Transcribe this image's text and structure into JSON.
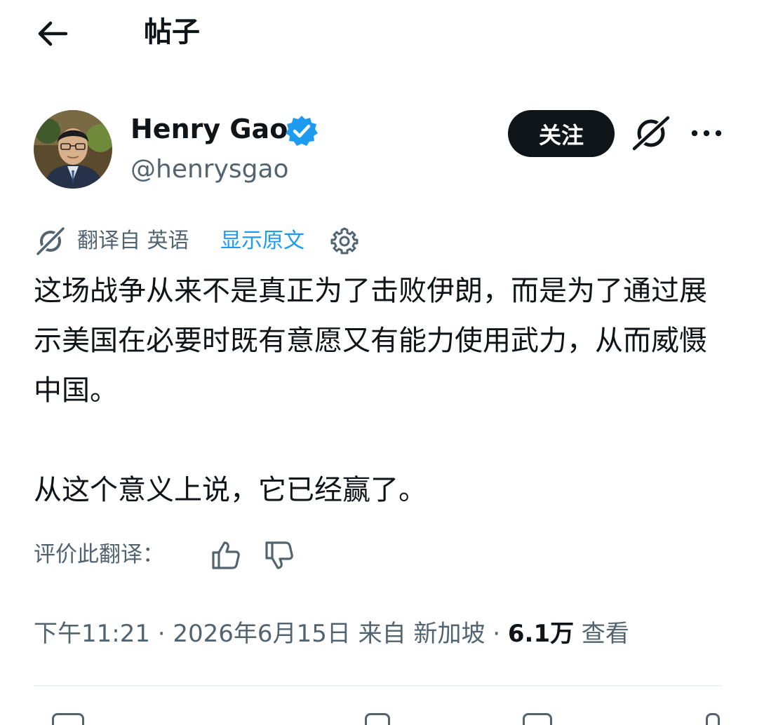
{
  "header": {
    "title": "帖子",
    "back_icon": "arrow-left-icon"
  },
  "author": {
    "name": "Henry Gao",
    "handle": "@henrysgao",
    "verified": true,
    "verified_color": "#1d9bf0",
    "follow_label": "关注",
    "grok_icon": "grok-icon",
    "more_icon": "more-horizontal-icon"
  },
  "translation": {
    "label": "翻译自 英语",
    "show_original": "显示原文",
    "settings_icon": "gear-icon"
  },
  "post": {
    "paragraphs": [
      "这场战争从来不是真正为了击败伊朗，而是为了通过展示美国在必要时既有意愿又有能力使用武力，从而威慑中国。",
      "从这个意义上说，它已经赢了。"
    ]
  },
  "rating": {
    "label": "评价此翻译：",
    "up_icon": "thumbs-up-icon",
    "down_icon": "thumbs-down-icon"
  },
  "meta": {
    "time_date_location": "下午11:21 · 2026年6月15日 来自 新加坡 · ",
    "views": "6.1万",
    "views_label": " 查看"
  },
  "colors": {
    "text": "#0f1419",
    "secondary": "#536471",
    "accent": "#1d9bf0",
    "button": "#0f1419"
  }
}
